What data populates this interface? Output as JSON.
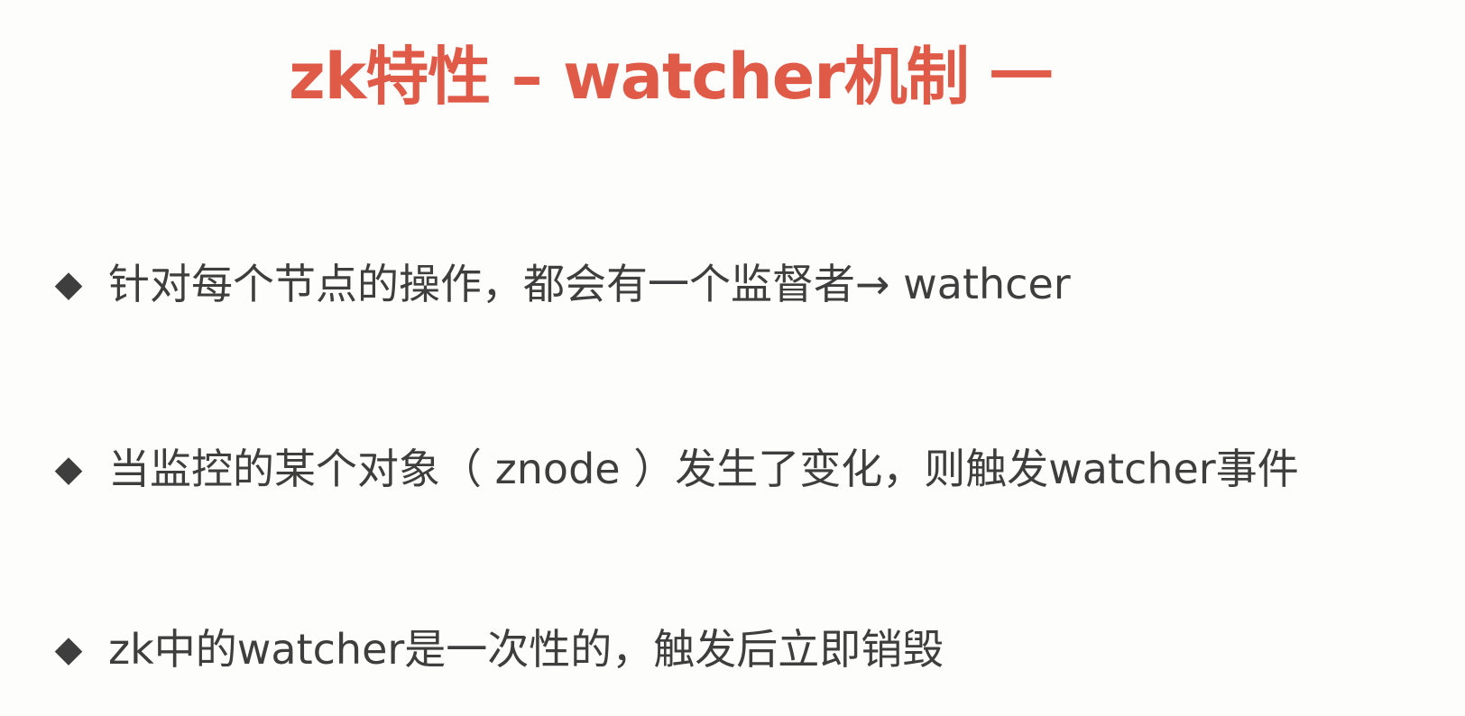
{
  "colors": {
    "title": "#e05a48",
    "text": "#3e3e3e",
    "background": "#fdfdfc"
  },
  "title": "zk特性 – watcher机制 一",
  "bullets": [
    {
      "icon": "diamond-bullet-icon",
      "glyph": "◆",
      "text": "针对每个节点的操作，都会有一个监督者→ wathcer"
    },
    {
      "icon": "diamond-bullet-icon",
      "glyph": "◆",
      "text": "当监控的某个对象（ znode ）发生了变化，则触发watcher事件"
    },
    {
      "icon": "diamond-bullet-icon",
      "glyph": "◆",
      "text": "zk中的watcher是一次性的，触发后立即销毁"
    }
  ]
}
